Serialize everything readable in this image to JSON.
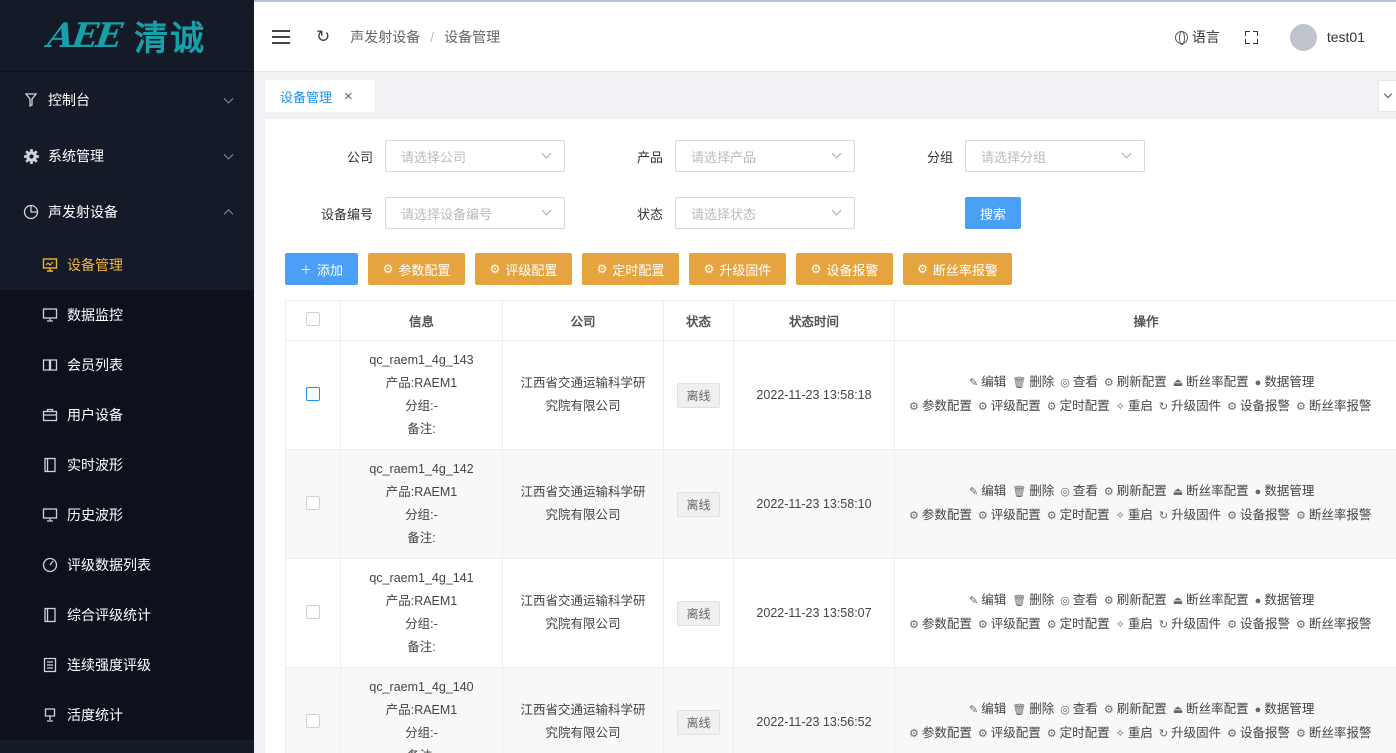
{
  "brand": {
    "mark": "AEE",
    "name": "清诚"
  },
  "sidebar": {
    "groups": [
      {
        "label": "控制台",
        "icon": "dashboard-icon"
      },
      {
        "label": "系统管理",
        "icon": "gear-icon"
      },
      {
        "label": "声发射设备",
        "icon": "pie-chart-icon"
      }
    ],
    "items": [
      {
        "label": "设备管理",
        "icon": "monitor-icon"
      },
      {
        "label": "数据监控",
        "icon": "monitor-icon"
      },
      {
        "label": "会员列表",
        "icon": "book-icon"
      },
      {
        "label": "用户设备",
        "icon": "briefcase-icon"
      },
      {
        "label": "实时波形",
        "icon": "sheet-icon"
      },
      {
        "label": "历史波形",
        "icon": "monitor-icon"
      },
      {
        "label": "评级数据列表",
        "icon": "gauge-icon"
      },
      {
        "label": "综合评级统计",
        "icon": "sheet-icon"
      },
      {
        "label": "连续强度评级",
        "icon": "list-icon"
      },
      {
        "label": "活度统计",
        "icon": "lamp-icon"
      }
    ]
  },
  "header": {
    "breadcrumb": [
      "声发射设备",
      "设备管理"
    ],
    "breadcrumb_sep": "/",
    "language": "语言",
    "username": "test01"
  },
  "tabs": [
    {
      "label": "设备管理",
      "close": "×"
    }
  ],
  "filters": {
    "company": {
      "label": "公司",
      "placeholder": "请选择公司"
    },
    "product": {
      "label": "产品",
      "placeholder": "请选择产品"
    },
    "group": {
      "label": "分组",
      "placeholder": "请选择分组"
    },
    "device_no": {
      "label": "设备编号",
      "placeholder": "请选择设备编号"
    },
    "status": {
      "label": "状态",
      "placeholder": "请选择状态"
    },
    "search": "搜索"
  },
  "actions": {
    "add": "添加",
    "buttons": [
      "参数配置",
      "评级配置",
      "定时配置",
      "升级固件",
      "设备报警",
      "断丝率报警"
    ]
  },
  "table": {
    "headers": [
      "信息",
      "公司",
      "状态",
      "状态时间",
      "操作"
    ],
    "rows": [
      {
        "name": "qc_raem1_4g_143",
        "product": "产品:RAEM1",
        "group": "分组:-",
        "note": "备注:",
        "company": "江西省交通运输科学研究院有限公司",
        "status": "离线",
        "time": "2022-11-23 13:58:18"
      },
      {
        "name": "qc_raem1_4g_142",
        "product": "产品:RAEM1",
        "group": "分组:-",
        "note": "备注:",
        "company": "江西省交通运输科学研究院有限公司",
        "status": "离线",
        "time": "2022-11-23 13:58:10"
      },
      {
        "name": "qc_raem1_4g_141",
        "product": "产品:RAEM1",
        "group": "分组:-",
        "note": "备注:",
        "company": "江西省交通运输科学研究院有限公司",
        "status": "离线",
        "time": "2022-11-23 13:58:07"
      },
      {
        "name": "qc_raem1_4g_140",
        "product": "产品:RAEM1",
        "group": "分组:-",
        "note": "备注:",
        "company": "江西省交通运输科学研究院有限公司",
        "status": "离线",
        "time": "2022-11-23 13:56:52"
      }
    ],
    "ops_line1": [
      "编辑",
      "删除",
      "查看",
      "刷新配置",
      "断丝率配置",
      "数据管理"
    ],
    "ops_line2": [
      "参数配置",
      "评级配置",
      "定时配置",
      "重启",
      "升级固件",
      "设备报警",
      "断丝率报警"
    ]
  }
}
